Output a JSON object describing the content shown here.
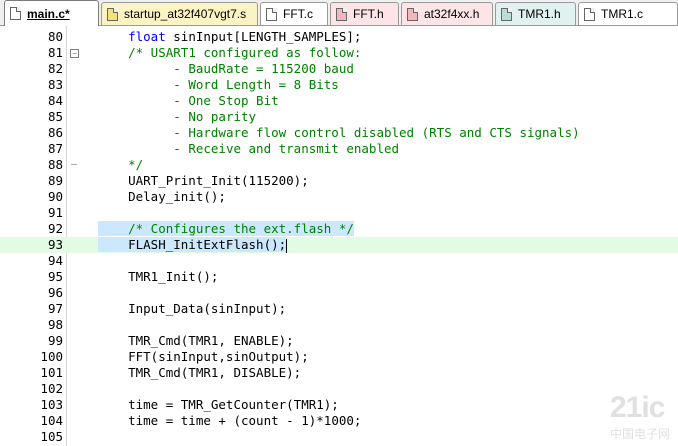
{
  "tabs": [
    {
      "label": "main.c*",
      "type": "c",
      "active": true
    },
    {
      "label": "startup_at32f407vgt7.s",
      "type": "s",
      "active": false
    },
    {
      "label": "FFT.c",
      "type": "c",
      "active": false
    },
    {
      "label": "FFT.h",
      "type": "h",
      "active": false
    },
    {
      "label": "at32f4xx.h",
      "type": "h",
      "active": false
    },
    {
      "label": "TMR1.h",
      "type": "t",
      "active": false
    },
    {
      "label": "TMR1.c",
      "type": "c",
      "active": false
    }
  ],
  "lines": [
    {
      "n": "80",
      "fold": "",
      "parts": [
        [
          "    ",
          ""
        ],
        [
          "float",
          "kw"
        ],
        [
          " sinInput[LENGTH_SAMPLES];",
          ""
        ]
      ]
    },
    {
      "n": "81",
      "fold": "box",
      "parts": [
        [
          "    ",
          ""
        ],
        [
          "/* USART1 configured as follow:",
          "cm"
        ]
      ]
    },
    {
      "n": "82",
      "fold": "",
      "parts": [
        [
          "          ",
          ""
        ],
        [
          "- BaudRate = 115200 baud",
          "cm"
        ]
      ]
    },
    {
      "n": "83",
      "fold": "",
      "parts": [
        [
          "          ",
          ""
        ],
        [
          "- Word Length = 8 Bits",
          "cm"
        ]
      ]
    },
    {
      "n": "84",
      "fold": "",
      "parts": [
        [
          "          ",
          ""
        ],
        [
          "- One Stop Bit",
          "cm"
        ]
      ]
    },
    {
      "n": "85",
      "fold": "",
      "parts": [
        [
          "          ",
          ""
        ],
        [
          "- No parity",
          "cm"
        ]
      ]
    },
    {
      "n": "86",
      "fold": "",
      "parts": [
        [
          "          ",
          ""
        ],
        [
          "- Hardware flow control disabled (RTS and CTS signals)",
          "cm"
        ]
      ]
    },
    {
      "n": "87",
      "fold": "",
      "parts": [
        [
          "          ",
          ""
        ],
        [
          "- Receive and transmit enabled",
          "cm"
        ]
      ]
    },
    {
      "n": "88",
      "fold": "end",
      "parts": [
        [
          "    ",
          ""
        ],
        [
          "*/",
          "cm"
        ]
      ]
    },
    {
      "n": "89",
      "fold": "",
      "parts": [
        [
          "    UART_Print_Init(",
          ""
        ],
        [
          "115200",
          "num"
        ],
        [
          ");",
          ""
        ]
      ]
    },
    {
      "n": "90",
      "fold": "",
      "parts": [
        [
          "    Delay_init();",
          ""
        ]
      ]
    },
    {
      "n": "91",
      "fold": "",
      "parts": []
    },
    {
      "n": "92",
      "fold": "",
      "sel": true,
      "parts": [
        [
          "    ",
          ""
        ],
        [
          "/* Configures the ext.flash */",
          "cm"
        ]
      ]
    },
    {
      "n": "93",
      "fold": "",
      "sel": true,
      "current": true,
      "caret": true,
      "parts": [
        [
          "    FLASH_InitExtFlash();",
          ""
        ]
      ]
    },
    {
      "n": "94",
      "fold": "",
      "parts": []
    },
    {
      "n": "95",
      "fold": "",
      "parts": [
        [
          "    TMR1_Init();",
          ""
        ]
      ]
    },
    {
      "n": "96",
      "fold": "",
      "parts": []
    },
    {
      "n": "97",
      "fold": "",
      "parts": [
        [
          "    Input_Data(sinInput);",
          ""
        ]
      ]
    },
    {
      "n": "98",
      "fold": "",
      "parts": []
    },
    {
      "n": "99",
      "fold": "",
      "parts": [
        [
          "    TMR_Cmd(TMR1, ENABLE);",
          ""
        ]
      ]
    },
    {
      "n": "100",
      "fold": "",
      "parts": [
        [
          "    FFT(sinInput,sinOutput);",
          ""
        ]
      ]
    },
    {
      "n": "101",
      "fold": "",
      "parts": [
        [
          "    TMR_Cmd(TMR1, DISABLE);",
          ""
        ]
      ]
    },
    {
      "n": "102",
      "fold": "",
      "parts": []
    },
    {
      "n": "103",
      "fold": "",
      "parts": [
        [
          "    time = TMR_GetCounter(TMR1);",
          ""
        ]
      ]
    },
    {
      "n": "104",
      "fold": "",
      "parts": [
        [
          "    time = time + (count - ",
          ""
        ],
        [
          "1",
          "num"
        ],
        [
          ")*",
          ""
        ],
        [
          "1000",
          "num"
        ],
        [
          ";",
          ""
        ]
      ]
    },
    {
      "n": "105",
      "fold": "",
      "parts": []
    }
  ],
  "watermark": {
    "main": "21ic",
    "sub": "中国电子网"
  }
}
